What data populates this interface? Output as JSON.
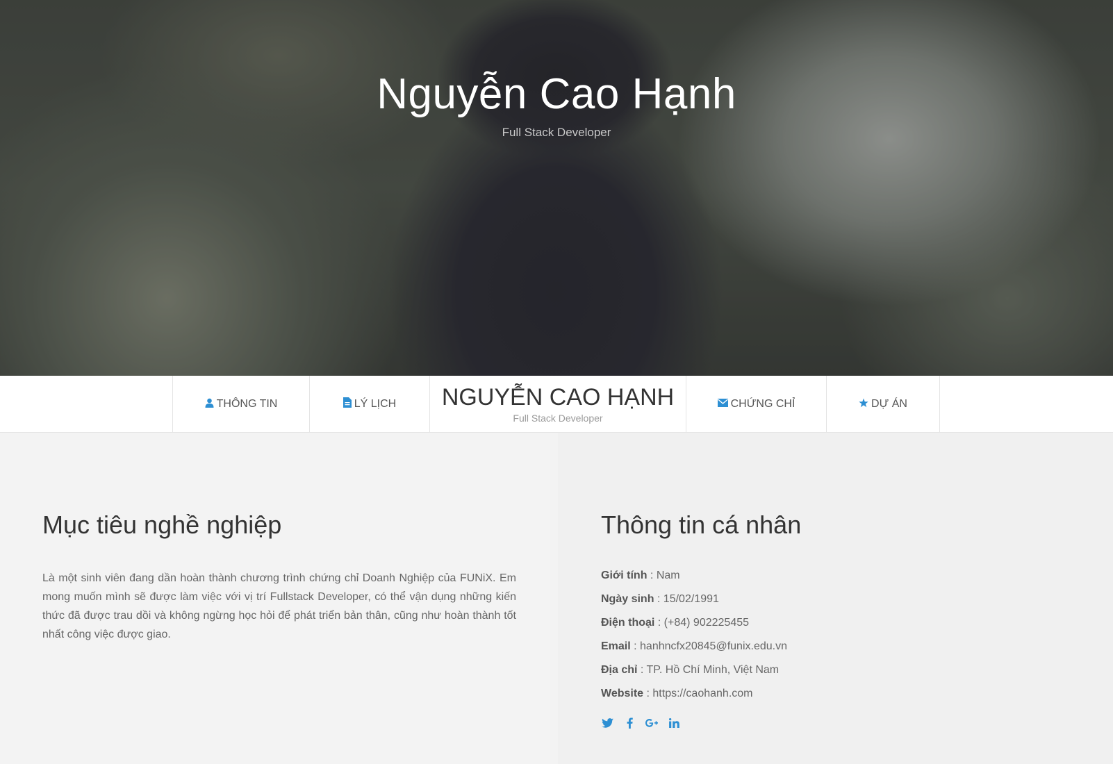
{
  "hero": {
    "name": "Nguyễn Cao Hạnh",
    "role": "Full Stack Developer"
  },
  "nav": {
    "items": [
      {
        "label": "THÔNG TIN",
        "icon": "user-icon"
      },
      {
        "label": "LÝ LỊCH",
        "icon": "file-icon"
      },
      {
        "label": "CHỨNG CHỈ",
        "icon": "envelope-icon"
      },
      {
        "label": "DỰ ÁN",
        "icon": "star-icon"
      }
    ],
    "brand_name": "Nguyễn Cao Hạnh",
    "brand_role": "Full Stack Developer"
  },
  "objective": {
    "title": "Mục tiêu nghề nghiệp",
    "text": "Là một sinh viên đang dần hoàn thành chương trình chứng chỉ Doanh Nghiệp của FUNiX. Em mong muốn mình sẽ được làm việc với vị trí Fullstack Developer, có thể vận dụng những kiến thức đã được trau dồi và không ngừng học hỏi để phát triển bản thân, cũng như hoàn thành tốt nhất công việc được giao."
  },
  "personal": {
    "title": "Thông tin cá nhân",
    "rows": [
      {
        "label": "Giới tính",
        "value": " : Nam"
      },
      {
        "label": "Ngày sinh",
        "value": " : 15/02/1991"
      },
      {
        "label": "Điện thoại",
        "value": " : (+84) 902225455"
      },
      {
        "label": "Email",
        "value": " : hanhncfx20845@funix.edu.vn"
      },
      {
        "label": "Địa chỉ",
        "value": " : TP. Hồ Chí Minh, Việt Nam"
      },
      {
        "label": "Website",
        "value": " : https://caohanh.com"
      }
    ],
    "social": [
      "twitter-icon",
      "facebook-icon",
      "google-plus-icon",
      "linkedin-icon"
    ]
  },
  "colors": {
    "accent": "#2d8fd3",
    "text": "#666666",
    "heading": "#333333"
  }
}
